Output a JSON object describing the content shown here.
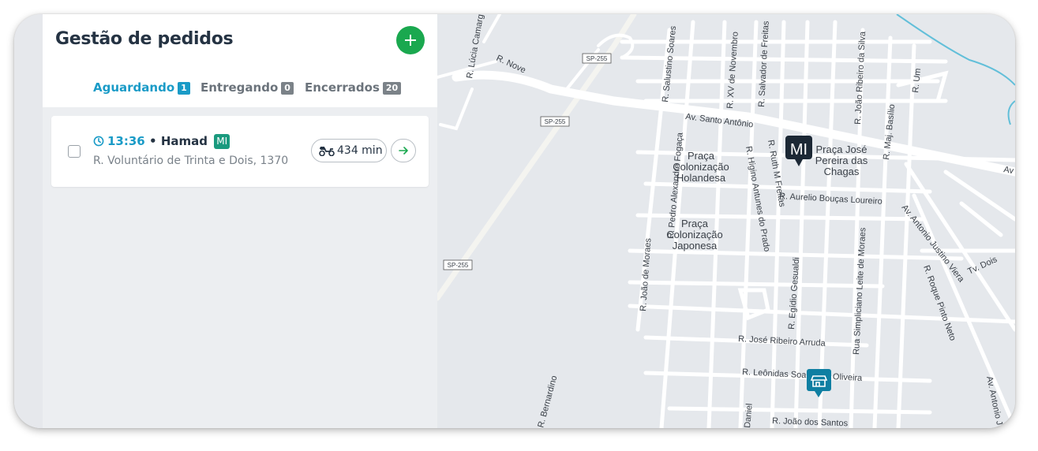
{
  "panel": {
    "title": "Gestão de pedidos",
    "add_icon": "plus-icon",
    "tabs": [
      {
        "label": "Aguardando",
        "count": "1",
        "active": true
      },
      {
        "label": "Entregando",
        "count": "0",
        "active": false
      },
      {
        "label": "Encerrados",
        "count": "20",
        "active": false
      }
    ]
  },
  "order": {
    "time": "13:36",
    "separator": "•",
    "customer": "Hamad",
    "tag": "MI",
    "address": "R. Voluntário de Trinta e Dois, 1370",
    "eta": "434 min",
    "clock_icon": "clock-icon",
    "eta_icon": "motorcycle-icon",
    "go_icon": "arrow-right-icon"
  },
  "map": {
    "customer_marker": "MI",
    "store_marker_icon": "store-icon",
    "labels": {
      "sp255": "SP-255",
      "r_nove": "R. Nove",
      "r_lucia": "R. Lúcia Camargo",
      "r_salustino": "R. Salustino Soares",
      "r_xv": "R. XV de Novembro",
      "r_salvador": "R. Salvador de Freitas",
      "r_joao_ribeiro": "R. João Ribeiro da Silva",
      "r_um": "R. Um",
      "r_maj": "R. Maj. Basílio",
      "av_santo": "Av. Santo Antônio",
      "av_edge": "Av",
      "r_pedro": "R. Pedro Alexandre Fogaça",
      "r_higino": "R. Higino Antunes do Prado",
      "r_ruth": "R. Ruth M Freitas",
      "praca_holandesa": [
        "Praça",
        "Colonização",
        "Holandesa"
      ],
      "praca_japonesa": [
        "Praça",
        "Colonização",
        "Japonesa"
      ],
      "praca_jose": [
        "Praça José",
        "Pereira das",
        "Chagas"
      ],
      "r_aurelio": "R. Aurelio Bouças Loureiro",
      "av_antonio": "Av. Antonio Justino Viera",
      "tv_dois": "Tv. Dois",
      "r_joao_moraes": "R. João de Moraes",
      "r_egidio": "R. Egídio Gesualdi",
      "rua_simpliciano": "Rua Simpliciano Leite de Moraes",
      "r_roque": "R. Roque Pinto Neto",
      "r_jose_ribeiro": "R. José Ribeiro Arruda",
      "r_leonidas": "R. Leônidas Soares da Oliveira",
      "r_joao_santos": "R. João dos Santos",
      "r_bernardino": "R. Bernardino",
      "daniel": "Daniel",
      "av_antonio2": "Av. Antonio J"
    },
    "colors": {
      "water": "#62bfd9",
      "road": "#ffffff",
      "land": "#e5e8ec",
      "marker_dark": "#1c2835",
      "marker_store": "#0f7fa2"
    }
  }
}
